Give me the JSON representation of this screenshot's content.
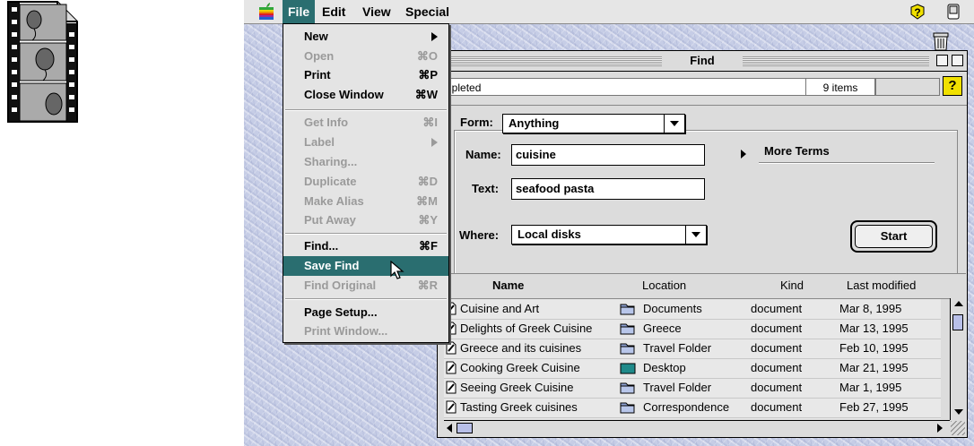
{
  "menubar": {
    "items": [
      "File",
      "Edit",
      "View",
      "Special"
    ],
    "active": "File"
  },
  "file_menu": {
    "items": [
      {
        "label": "New",
        "shortcut": "",
        "enabled": true,
        "submenu": true
      },
      {
        "label": "Open",
        "shortcut": "⌘O",
        "enabled": false
      },
      {
        "label": "Print",
        "shortcut": "⌘P",
        "enabled": true
      },
      {
        "label": "Close Window",
        "shortcut": "⌘W",
        "enabled": true
      },
      {
        "label": "Get Info",
        "shortcut": "⌘I",
        "enabled": false
      },
      {
        "label": "Label",
        "shortcut": "",
        "enabled": false,
        "submenu": true
      },
      {
        "label": "Sharing...",
        "shortcut": "",
        "enabled": false
      },
      {
        "label": "Duplicate",
        "shortcut": "⌘D",
        "enabled": false
      },
      {
        "label": "Make Alias",
        "shortcut": "⌘M",
        "enabled": false
      },
      {
        "label": "Put Away",
        "shortcut": "⌘Y",
        "enabled": false
      },
      {
        "label": "Find...",
        "shortcut": "⌘F",
        "enabled": true
      },
      {
        "label": "Save Find",
        "shortcut": "",
        "enabled": true,
        "highlighted": true
      },
      {
        "label": "Find Original",
        "shortcut": "⌘R",
        "enabled": false
      },
      {
        "label": "Page Setup...",
        "shortcut": "",
        "enabled": true
      },
      {
        "label": "Print Window...",
        "shortcut": "",
        "enabled": false
      }
    ]
  },
  "window": {
    "title": "Find",
    "status": "npleted",
    "items_count": "9 items",
    "help_label": "?",
    "form_label": "Form:",
    "form_value": "Anything",
    "name_label": "Name:",
    "name_value": "cuisine",
    "text_label": "Text:",
    "text_value": "seafood pasta",
    "where_label": "Where:",
    "where_value": "Local disks",
    "more_terms": "More Terms",
    "start_label": "Start"
  },
  "results": {
    "columns": [
      "Name",
      "Location",
      "Kind",
      "Last modified"
    ],
    "rows": [
      {
        "name": "Cuisine and Art",
        "location": "Documents",
        "kind": "document",
        "modified": "Mar 8, 1995"
      },
      {
        "name": "Delights of Greek Cuisine",
        "location": "Greece",
        "kind": "document",
        "modified": "Mar 13, 1995"
      },
      {
        "name": "Greece and its cuisines",
        "location": "Travel Folder",
        "kind": "document",
        "modified": "Feb 10, 1995"
      },
      {
        "name": "Cooking Greek Cuisine",
        "location": "Desktop",
        "kind": "document",
        "modified": "Mar 21, 1995"
      },
      {
        "name": "Seeing Greek Cuisine",
        "location": "Travel Folder",
        "kind": "document",
        "modified": "Mar 1, 1995"
      },
      {
        "name": "Tasting Greek cuisines",
        "location": "Correspondence",
        "kind": "document",
        "modified": "Feb 27, 1995"
      }
    ]
  },
  "colors": {
    "highlight": "#2a6e70",
    "help_yellow": "#f0e000",
    "desktop": "#c6cde6"
  },
  "icons": [
    "film-document-icon",
    "apple-icon",
    "help-icon",
    "app-switcher-icon",
    "trash-icon",
    "document-icon",
    "folder-icon",
    "arrow-cursor-icon"
  ]
}
